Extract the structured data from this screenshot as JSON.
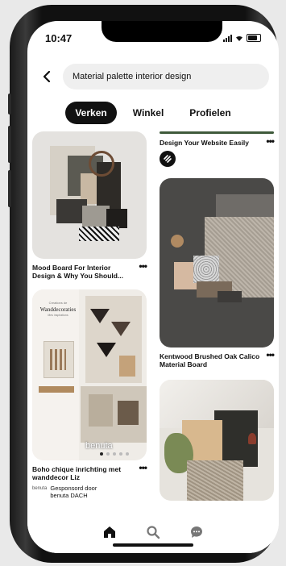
{
  "status": {
    "time": "10:47"
  },
  "search": {
    "query": "Material palette interior design"
  },
  "tabs": [
    {
      "label": "Verken"
    },
    {
      "label": "Winkel"
    },
    {
      "label": "Profielen"
    }
  ],
  "pins": {
    "p1": {
      "title": "Mood Board For Interior Design & Why You Should..."
    },
    "p2": {
      "title": "Boho chique inrichting met wanddecor Liz",
      "overlay_small": "Creations de",
      "overlay_title": "Wanddecoraties",
      "overlay_sub": "Mes inspirations",
      "brand": "benuta",
      "sponsor_avatar": "benuta",
      "sponsor": "Gesponsord door benuta DACH"
    },
    "p3": {
      "title": "Design Your Website Easily"
    },
    "p4": {
      "title": "Kentwood Brushed Oak Calico Material Board"
    }
  },
  "accent": "#111111"
}
